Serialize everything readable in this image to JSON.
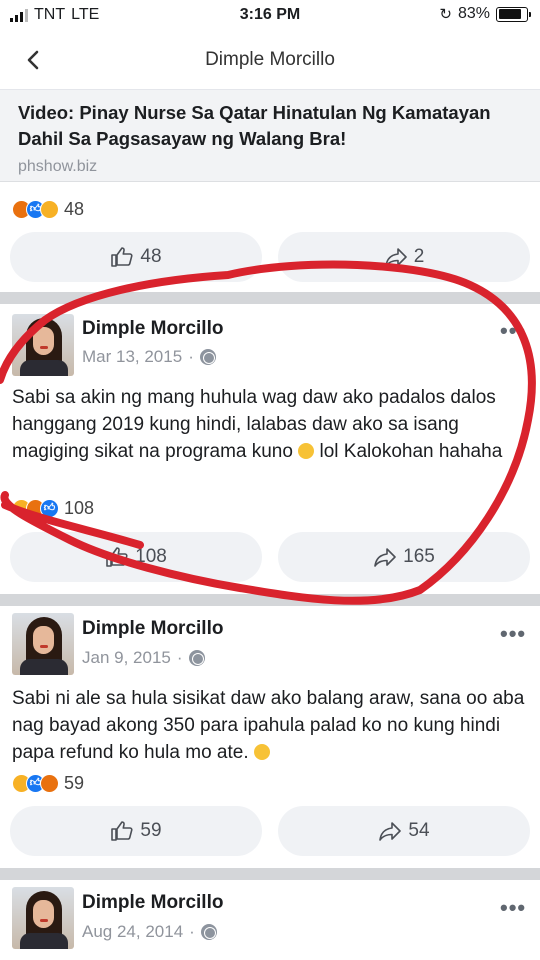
{
  "status_bar": {
    "carrier": "TNT",
    "network": "LTE",
    "time": "3:16 PM",
    "battery": "83%",
    "battery_level": 0.83
  },
  "nav": {
    "back_icon": "chevron-left-icon",
    "title": "Dimple Morcillo"
  },
  "link_preview": {
    "headline": "Video: Pinay Nurse Sa Qatar Hinatulan Ng Kamatayan Dahil Sa Pagsasayaw ng Walang Bra!",
    "domain": "phshow.biz"
  },
  "post0": {
    "reactions_count": "48",
    "like_count": "48",
    "share_count": "2"
  },
  "posts": [
    {
      "author": "Dimple Morcillo",
      "date": "Mar 13, 2015",
      "text": "Sabi sa akin ng mang huhula wag daw ako padalos dalos hanggang 2019 kung hindi, lalabas daw ako sa isang magiging sikat na programa kuno",
      "text_tail": " lol Kalokohan hahaha",
      "reactions_count": "108",
      "like_count": "108",
      "share_count": "165"
    },
    {
      "author": "Dimple Morcillo",
      "date": "Jan 9, 2015",
      "text": "Sabi ni ale sa hula sisikat daw ako balang araw, sana oo aba nag bayad akong 350 para ipahula palad ko no kung hindi papa refund ko hula mo ate.",
      "reactions_count": "59",
      "like_count": "59",
      "share_count": "54"
    },
    {
      "author": "Dimple Morcillo",
      "date": "Aug 24, 2014"
    }
  ],
  "colors": {
    "annotation_red": "#d9232d",
    "like_blue": "#1877f2"
  }
}
